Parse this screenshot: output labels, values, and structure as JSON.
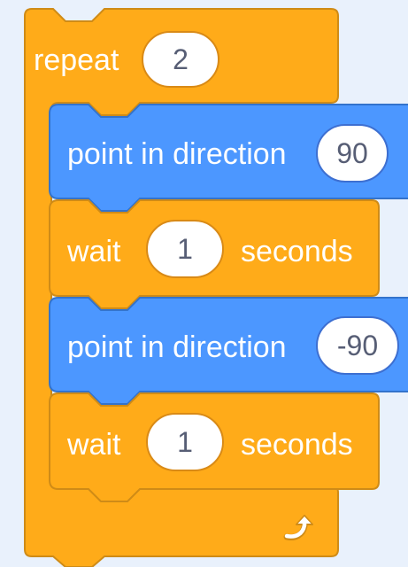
{
  "colors": {
    "background": "#e9f1fc",
    "control_orange": "#ffab19",
    "control_orange_border": "#cf8b17",
    "motion_blue": "#4c97ff",
    "motion_blue_border": "#3373cc",
    "input_text": "#575e75"
  },
  "repeat_block": {
    "label": "repeat",
    "count": "2",
    "loop_icon": "loop-arrow-icon"
  },
  "inner_blocks": [
    {
      "kind": "motion",
      "label": "point in direction",
      "value": "90"
    },
    {
      "kind": "control",
      "label": "wait",
      "value": "1",
      "suffix": "seconds"
    },
    {
      "kind": "motion",
      "label": "point in direction",
      "value": "-90"
    },
    {
      "kind": "control",
      "label": "wait",
      "value": "1",
      "suffix": "seconds"
    }
  ]
}
